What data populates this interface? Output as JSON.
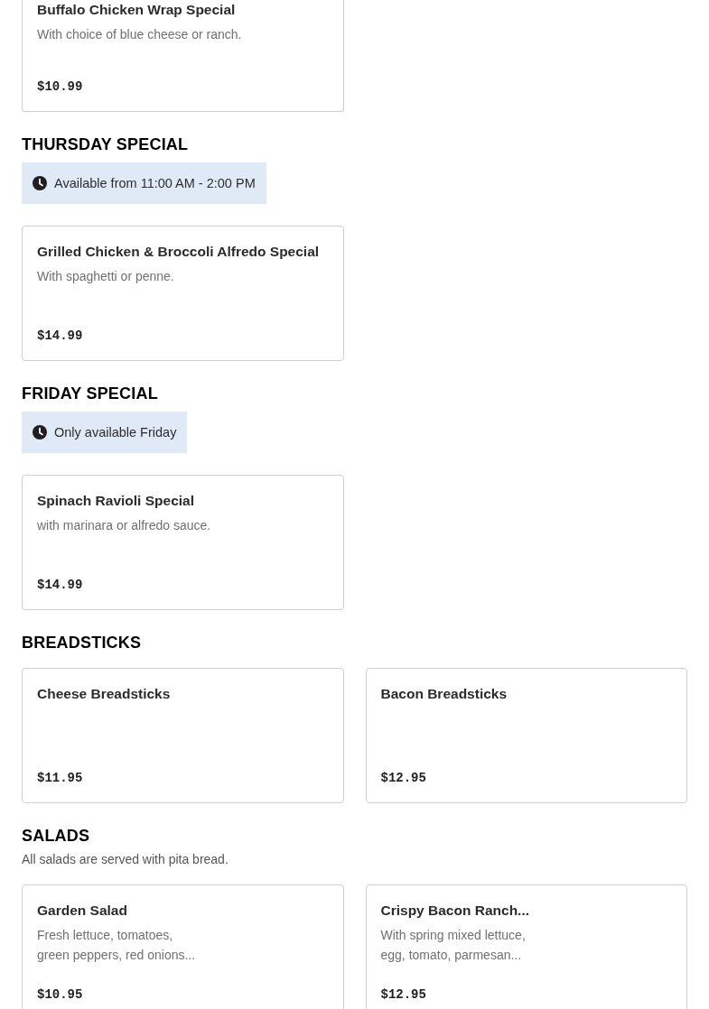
{
  "sections": [
    {
      "items": [
        {
          "name": "Buffalo Chicken Wrap Special",
          "description": "With choice of blue cheese or ranch.",
          "price": "$10.99"
        }
      ]
    },
    {
      "heading": "THURSDAY SPECIAL",
      "notice": "Available from 11:00 AM - 2:00 PM",
      "items": [
        {
          "name": "Grilled Chicken & Broccoli Alfredo Special",
          "description": "With spaghetti or penne.",
          "price": "$14.99"
        }
      ]
    },
    {
      "heading": "FRIDAY SPECIAL",
      "notice": "Only available Friday",
      "items": [
        {
          "name": "Spinach Ravioli Special",
          "description": "with marinara or alfredo sauce.",
          "price": "$14.99"
        }
      ]
    },
    {
      "heading": "BREADSTICKS",
      "items": [
        {
          "name": "Cheese Breadsticks",
          "price": "$11.95"
        },
        {
          "name": "Bacon Breadsticks",
          "price": "$12.95"
        }
      ]
    },
    {
      "heading": "SALADS",
      "description": "All salads are served with pita bread.",
      "items": [
        {
          "name": "Garden Salad",
          "description": "Fresh lettuce, tomatoes,\ngreen peppers, red onions...",
          "price": "$10.95"
        },
        {
          "name": "Crispy Bacon Ranch...",
          "description": "With spring mixed lettuce,\negg, tomato, parmesan...",
          "price": "$12.95"
        }
      ]
    }
  ]
}
